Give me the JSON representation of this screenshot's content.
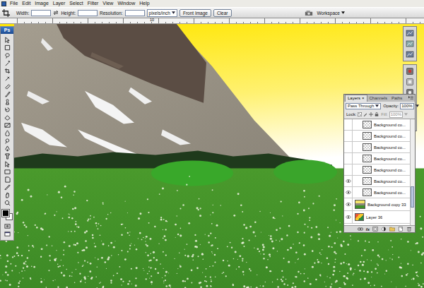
{
  "app": {
    "logo": "Ps"
  },
  "menu": [
    "File",
    "Edit",
    "Image",
    "Layer",
    "Select",
    "Filter",
    "View",
    "Window",
    "Help"
  ],
  "options_bar": {
    "fields": [
      {
        "label": "Width:",
        "value": ""
      },
      {
        "label": "Height:",
        "value": ""
      },
      {
        "label": "Resolution:",
        "value": ""
      }
    ],
    "unit_dropdown": "pixels/inch",
    "buttons": [
      "Front Image",
      "Clear"
    ],
    "workspace": "Workspace"
  },
  "ruler": {
    "ticks": [
      "10"
    ]
  },
  "layers_panel": {
    "tabs": [
      {
        "label": "Layers",
        "selected": true,
        "close": "×"
      },
      {
        "label": "Channels",
        "selected": false,
        "close": ""
      },
      {
        "label": "Paths",
        "selected": false,
        "close": ""
      }
    ],
    "blend_mode": "Pass Through",
    "opacity_label": "Opacity:",
    "opacity": "100%",
    "lock_label": "Lock:",
    "fill_label": "Fill:",
    "fill": "100%",
    "fill_disabled": true,
    "fx_label": "fx",
    "layers": [
      {
        "name": "Background co...",
        "visible": false,
        "selected": false,
        "kind": "nested"
      },
      {
        "name": "Background co...",
        "visible": false,
        "selected": false,
        "kind": "nested"
      },
      {
        "name": "Background co...",
        "visible": false,
        "selected": false,
        "kind": "nested"
      },
      {
        "name": "Background co...",
        "visible": false,
        "selected": false,
        "kind": "nested"
      },
      {
        "name": "Background co...",
        "visible": false,
        "selected": false,
        "kind": "nested"
      },
      {
        "name": "Background co...",
        "visible": true,
        "selected": false,
        "kind": "nested"
      },
      {
        "name": "Background co...",
        "visible": true,
        "selected": false,
        "kind": "nested"
      },
      {
        "name": "Background copy 33",
        "visible": true,
        "selected": false,
        "kind": "photo"
      },
      {
        "name": "Layer 36",
        "visible": true,
        "selected": false,
        "kind": "paint"
      }
    ]
  }
}
